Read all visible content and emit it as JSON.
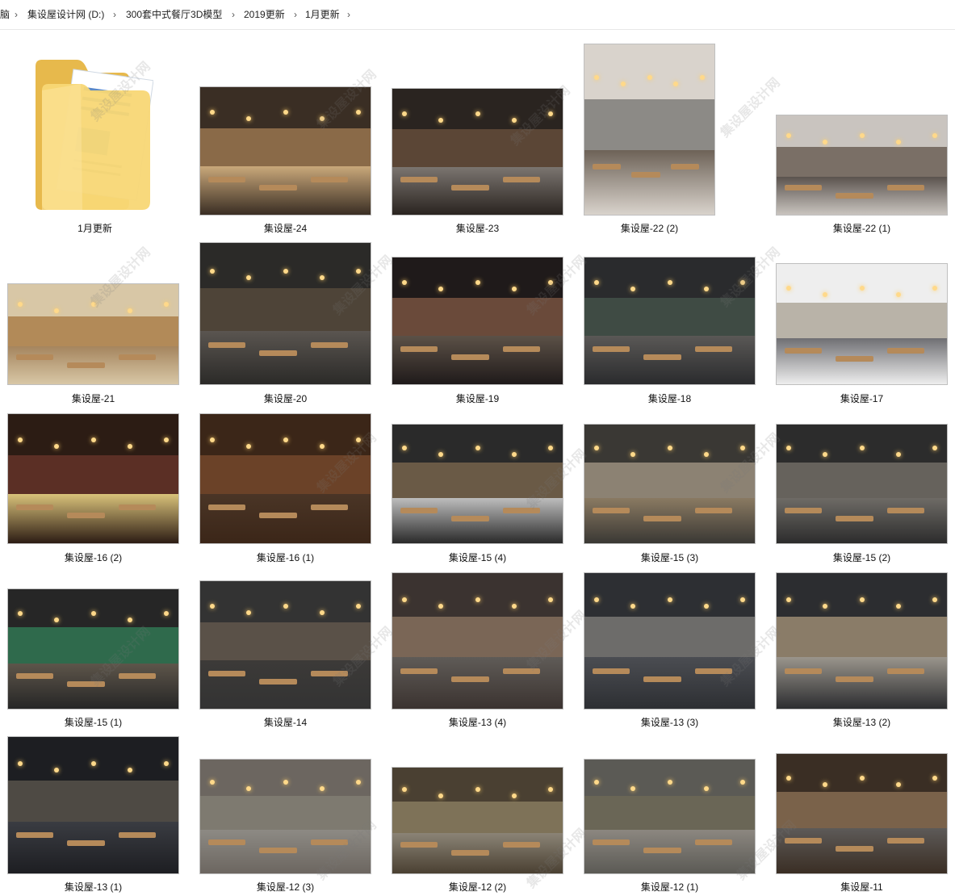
{
  "breadcrumb": {
    "items": [
      "脑",
      "集设屋设计网 (D:)",
      "300套中式餐厅3D模型",
      "2019更新",
      "1月更新"
    ],
    "separator": "›"
  },
  "folder": {
    "name": "1月更新",
    "icon": "folder-icon"
  },
  "files": [
    {
      "name": "集设屋-24"
    },
    {
      "name": "集设屋-23"
    },
    {
      "name": "集设屋-22 (2)"
    },
    {
      "name": "集设屋-22 (1)"
    },
    {
      "name": "集设屋-21"
    },
    {
      "name": "集设屋-20"
    },
    {
      "name": "集设屋-19"
    },
    {
      "name": "集设屋-18"
    },
    {
      "name": "集设屋-17"
    },
    {
      "name": "集设屋-16 (2)"
    },
    {
      "name": "集设屋-16 (1)"
    },
    {
      "name": "集设屋-15 (4)"
    },
    {
      "name": "集设屋-15 (3)"
    },
    {
      "name": "集设屋-15 (2)"
    },
    {
      "name": "集设屋-15 (1)"
    },
    {
      "name": "集设屋-14"
    },
    {
      "name": "集设屋-13 (4)"
    },
    {
      "name": "集设屋-13 (3)"
    },
    {
      "name": "集设屋-13 (2)"
    },
    {
      "name": "集设屋-13 (1)"
    },
    {
      "name": "集设屋-12 (3)"
    },
    {
      "name": "集设屋-12 (2)"
    },
    {
      "name": "集设屋-12 (1)"
    },
    {
      "name": "集设屋-11"
    }
  ],
  "watermark": "集设屋设计网"
}
